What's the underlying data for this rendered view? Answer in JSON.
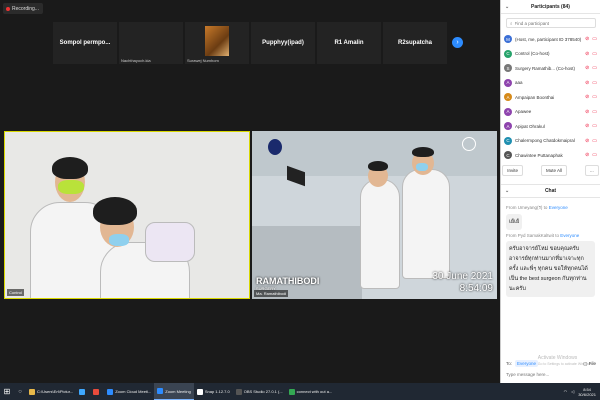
{
  "recording": {
    "label": "Recording..."
  },
  "gallery": {
    "tiles": [
      {
        "name": "Sompol permpo...",
        "sub": ""
      },
      {
        "name": "",
        "sub": "Nachthayoch.kia"
      },
      {
        "name": "",
        "sub": "Surawej Numhom"
      },
      {
        "name": "Pupphyy(ipad)",
        "sub": ""
      },
      {
        "name": "R1 Amalin",
        "sub": ""
      },
      {
        "name": "R2supatcha",
        "sub": ""
      }
    ],
    "next_icon": "chevron-right-icon"
  },
  "videos": {
    "left_name": "Control",
    "right_name": "Ma. Ramathibodi",
    "right_date": "30 June 2021",
    "right_time": "8:54:09",
    "right_brand": "RAMATHIBODI",
    "right_brand_sub": "SURGERY"
  },
  "participants": {
    "title": "Participants (84)",
    "search_placeholder": "Find a participant",
    "rows": [
      {
        "initials": "M",
        "color": "#3b6fd6",
        "name": "(Host, me, participant ID 378540)"
      },
      {
        "initials": "C",
        "color": "#27a36b",
        "name": "Control (Co-host)"
      },
      {
        "initials": "S",
        "color": "#777777",
        "name": "Surgery Ramathib... (Co-host)"
      },
      {
        "initials": "A",
        "color": "#8e44ad",
        "name": "aaa"
      },
      {
        "initials": "A",
        "color": "#d68a1a",
        "name": "Ampaipan Boonthai"
      },
      {
        "initials": "A",
        "color": "#8e44ad",
        "name": "Apawee"
      },
      {
        "initials": "A",
        "color": "#8e44ad",
        "name": "Apipat Ohrakul"
      },
      {
        "initials": "C",
        "color": "#1f8fb0",
        "name": "Chalermpong Chatdokmaipral"
      },
      {
        "initials": "C",
        "color": "#555555",
        "name": "Chawintee Puttanaphak"
      }
    ],
    "invite_label": "Invite",
    "mute_all_label": "Mute All",
    "more_label": "..."
  },
  "chat": {
    "title": "Chat",
    "messages": [
      {
        "from": "From Umeyang(ร) to ",
        "to": "Everyone",
        "text": "เย้เย้"
      },
      {
        "from": "From Pyd SamakKaltwit to ",
        "to": "Everyone",
        "text": "ครับอาจารย์โหม่ ขอบคุณครับ อาจารย์ทุกท่านมากที่มาเจาะทุกครั้ง และพี่ๆ ทุกคน ขอให้ทุกคนได้เป็น the best surgeon กันทุกท่านนะครับ"
      }
    ],
    "to_label": "To:",
    "to_value": "Everyone",
    "file_label": "File",
    "input_placeholder": "Type message here...",
    "watermark_line1": "Activate Windows",
    "watermark_line2": "Go to Settings to activate Windows."
  },
  "taskbar": {
    "items": [
      {
        "label": "C:\\Users\\Ert\\Pictur...",
        "color": "#e7b84a",
        "active": false
      },
      {
        "label": "",
        "color": "#3ea8ff",
        "active": false
      },
      {
        "label": "",
        "color": "#e84b3c",
        "active": false
      },
      {
        "label": "Zoom Cloud Meeti...",
        "color": "#2d8cff",
        "active": false
      },
      {
        "label": "Zoom Meeting",
        "color": "#2d8cff",
        "active": true
      },
      {
        "label": "Snap 1.12.7.0",
        "color": "#ffffff",
        "active": false
      },
      {
        "label": "OBS Studio 27.0.1 (...",
        "color": "#555555",
        "active": false
      },
      {
        "label": "connect with out a...",
        "color": "#34a853",
        "active": false
      }
    ],
    "time": "8:54",
    "date": "30/6/2021"
  }
}
